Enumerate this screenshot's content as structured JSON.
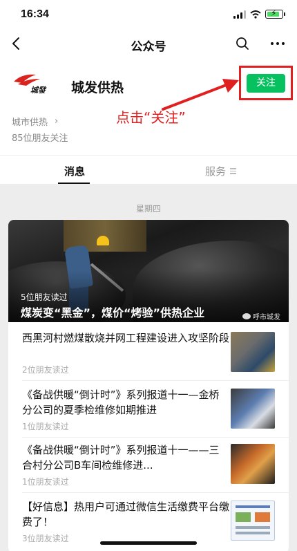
{
  "status_bar": {
    "time": "16:34"
  },
  "nav": {
    "title": "公众号"
  },
  "profile": {
    "name": "城发供热",
    "follow_label": "关注",
    "annotation": "点击“关注”",
    "category": "城市供热",
    "friends_following": "85位朋友关注"
  },
  "tabs": {
    "messages": "消息",
    "services": "服务"
  },
  "date_label": "星期四",
  "featured": {
    "reads": "5位朋友读过",
    "title": "煤炭变“黑金”，煤价“烤验”供热企业",
    "source": "呼市城发"
  },
  "articles": [
    {
      "title": "西黑河村燃煤散烧并网工程建设进入攻坚阶段",
      "reads": "2位朋友读过"
    },
    {
      "title": "《备战供暖“倒计时”》系列报道十一—金桥分公司的夏季检维修如期推进",
      "reads": "1位朋友读过"
    },
    {
      "title": "《备战供暖“倒计时”》系列报道十一——三合村分公司B车间检维修进...",
      "reads": "1位朋友读过"
    },
    {
      "title": "【好信息】热用户可通过微信生活缴费平台缴费了！",
      "reads": "3位朋友读过"
    }
  ],
  "colors": {
    "follow_green": "#07c160",
    "annotation_red": "#e02020"
  },
  "icons": [
    "back-arrow-icon",
    "search-icon",
    "more-icon",
    "chevron-right-icon",
    "menu-lines-icon",
    "wechat-icon"
  ]
}
